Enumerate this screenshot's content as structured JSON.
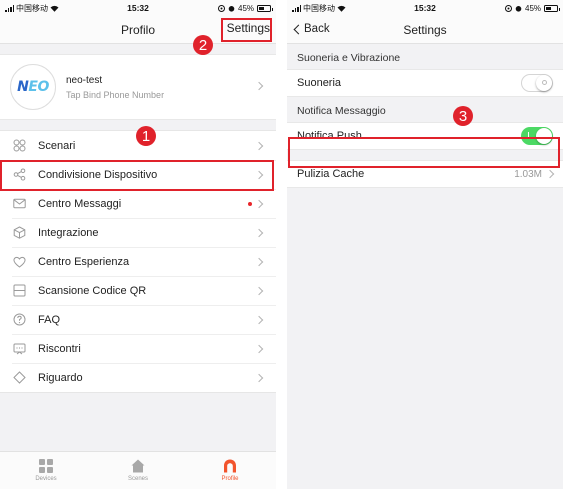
{
  "status_left": {
    "carrier": "中国移动",
    "time": "15:32",
    "battery": "45%"
  },
  "status_right": {
    "carrier": "中国移动",
    "time": "15:32",
    "battery": "45%"
  },
  "profile_screen": {
    "title": "Profilo",
    "settings_label": "Settings",
    "user": {
      "name": "neo-test",
      "subtitle": "Tap Bind Phone Number",
      "logo_text_a": "N",
      "logo_text_b": "EO"
    },
    "menu": [
      {
        "label": "Scenari",
        "icon": "scenes-icon"
      },
      {
        "label": "Condivisione Dispositivo",
        "icon": "share-icon"
      },
      {
        "label": "Centro Messaggi",
        "icon": "mail-icon",
        "unread_dot": true
      },
      {
        "label": "Integrazione",
        "icon": "cube-icon"
      },
      {
        "label": "Centro Esperienza",
        "icon": "heart-icon"
      },
      {
        "label": "Scansione Codice QR",
        "icon": "scan-icon"
      },
      {
        "label": "FAQ",
        "icon": "question-icon"
      },
      {
        "label": "Riscontri",
        "icon": "feedback-icon"
      },
      {
        "label": "Riguardo",
        "icon": "diamond-icon"
      }
    ],
    "tabs": [
      {
        "label": "Devices",
        "icon": "grid-icon",
        "active": false
      },
      {
        "label": "Scenes",
        "icon": "home-icon",
        "active": false
      },
      {
        "label": "Profile",
        "icon": "profile-icon",
        "active": true
      }
    ]
  },
  "settings_screen": {
    "back_label": "Back",
    "title": "Settings",
    "sections": [
      {
        "header": "Suoneria e Vibrazione",
        "label": "Suoneria",
        "toggle": "off"
      },
      {
        "header": "Notifica Messaggio",
        "label": "Notifica Push",
        "toggle": "on"
      },
      {
        "header": "",
        "label": "Pulizia Cache",
        "value": "1.03M"
      }
    ]
  },
  "annotations": {
    "step1": "1",
    "step2": "2",
    "step3": "3"
  },
  "colors": {
    "highlight": "#e0222b",
    "toggle_on": "#4cd964",
    "accent": "#f2542d",
    "unread_dot": "#e8262b"
  }
}
